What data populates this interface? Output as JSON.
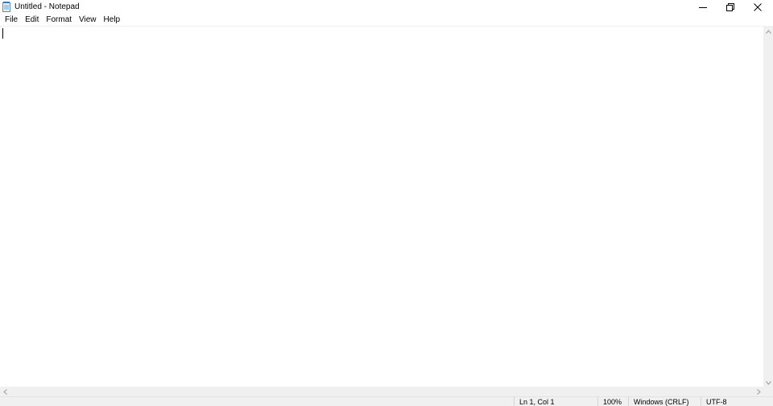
{
  "window": {
    "title": "Untitled - Notepad",
    "app_icon": "notepad-icon",
    "controls": {
      "minimize": "minimize-icon",
      "maximize": "restore-icon",
      "close": "close-icon"
    }
  },
  "menu": {
    "items": [
      {
        "label": "File"
      },
      {
        "label": "Edit"
      },
      {
        "label": "Format"
      },
      {
        "label": "View"
      },
      {
        "label": "Help"
      }
    ]
  },
  "editor": {
    "value": ""
  },
  "status": {
    "position": "Ln 1, Col 1",
    "zoom": "100%",
    "line_endings": "Windows (CRLF)",
    "encoding": "UTF-8"
  },
  "colors": {
    "chrome": "#f0f0f0",
    "background": "#ffffff",
    "text": "#000000"
  }
}
